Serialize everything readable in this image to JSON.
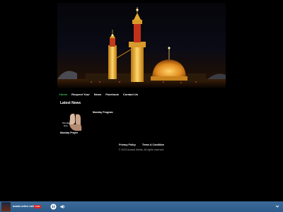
{
  "nav": {
    "items": [
      "Home",
      "Request Your",
      "News",
      "Facebook",
      "Contact Us"
    ]
  },
  "news": {
    "section_title": "Latest News",
    "thumb_caption": "Monday Prayer",
    "side_title": "Monday Program",
    "image_text": [
      "Monday",
      "Dua"
    ]
  },
  "footer": {
    "privacy": "Privacy Policy",
    "terms": "Terms & Condition",
    "copyright": "© 2023 Azadar Media. All rights reserved."
  },
  "player": {
    "title": "azadar online radio",
    "live": "LIVE"
  },
  "colors": {
    "accent_nav_active": "#39c15a",
    "player_bar": "#2f5d8c",
    "live_badge": "#d62020"
  }
}
